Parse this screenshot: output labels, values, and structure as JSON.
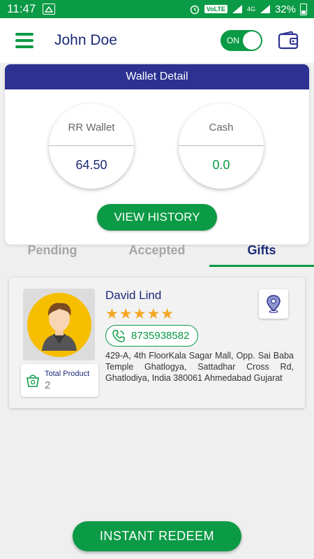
{
  "status_bar": {
    "time": "11:47",
    "network": "VoLTE",
    "signal_label": "4G",
    "battery": "32%"
  },
  "app_bar": {
    "user_name": "John Doe",
    "toggle_label": "ON"
  },
  "wallet": {
    "title": "Wallet Detail",
    "rr_label": "RR Wallet",
    "rr_value": "64.50",
    "cash_label": "Cash",
    "cash_value": "0.0",
    "history_button": "VIEW HISTORY"
  },
  "tabs": [
    {
      "label": "Pending"
    },
    {
      "label": "Accepted"
    },
    {
      "label": "Gifts"
    }
  ],
  "active_tab": "Gifts",
  "gift": {
    "name": "David Lind",
    "rating": 5,
    "rating_stars": "★★★★★",
    "phone": "8735938582",
    "address": "429-A, 4th FloorKala Sagar Mall, Opp. Sai Baba Temple Ghatlogya, Sattadhar Cross Rd, Ghatlodiya, India 380061 Ahmedabad Gujarat",
    "total_product_label": "Total Product",
    "total_product_count": "2"
  },
  "instant_redeem_label": "INSTANT REDEEM",
  "colors": {
    "primary_green": "#0b9a45",
    "header_blue": "#2c3192",
    "text_navy": "#1b2a78",
    "star": "#f5a623"
  }
}
